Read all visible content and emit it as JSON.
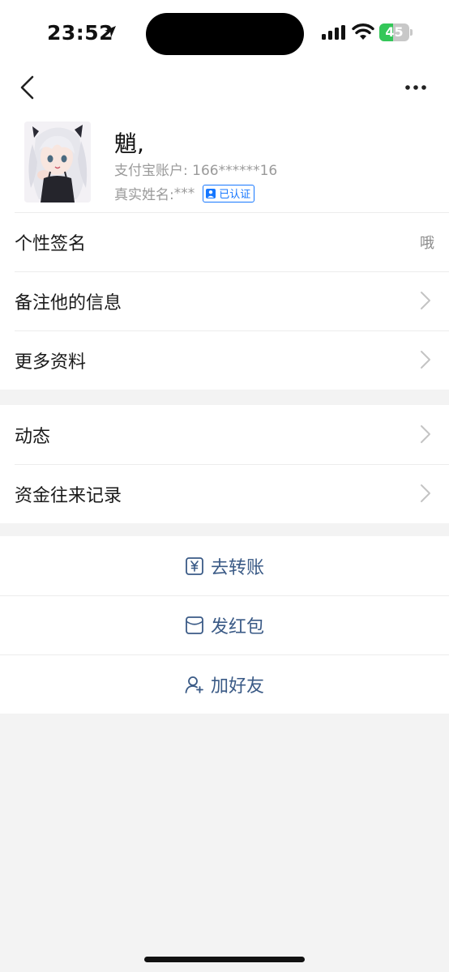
{
  "status_bar": {
    "time": "23:52",
    "battery_level": "45",
    "battery_fraction": 0.45,
    "icons": [
      "location-arrow-icon",
      "signal-icon",
      "wifi-icon",
      "battery-icon"
    ]
  },
  "header": {
    "name": "魈,",
    "account_label": "支付宝账户: ",
    "account_value": "166******16",
    "realname_label": "真实姓名: ",
    "realname_value": "***",
    "verified_badge": "已认证"
  },
  "info_section": {
    "items": [
      {
        "label": "个性签名",
        "value": "哦"
      },
      {
        "label": "备注他的信息"
      },
      {
        "label": "更多资料"
      }
    ]
  },
  "activity_section": {
    "items": [
      {
        "label": "动态"
      },
      {
        "label": "资金往来记录"
      }
    ]
  },
  "actions": {
    "items": [
      {
        "label": "去转账",
        "icon": "transfer-yuan-icon"
      },
      {
        "label": "发红包",
        "icon": "red-packet-icon"
      },
      {
        "label": "加好友",
        "icon": "add-friend-icon"
      }
    ]
  },
  "colors": {
    "accent_blue": "#1677ff",
    "action_text": "#3a5a86",
    "battery_green": "#34c759",
    "background": "#f3f3f3"
  }
}
